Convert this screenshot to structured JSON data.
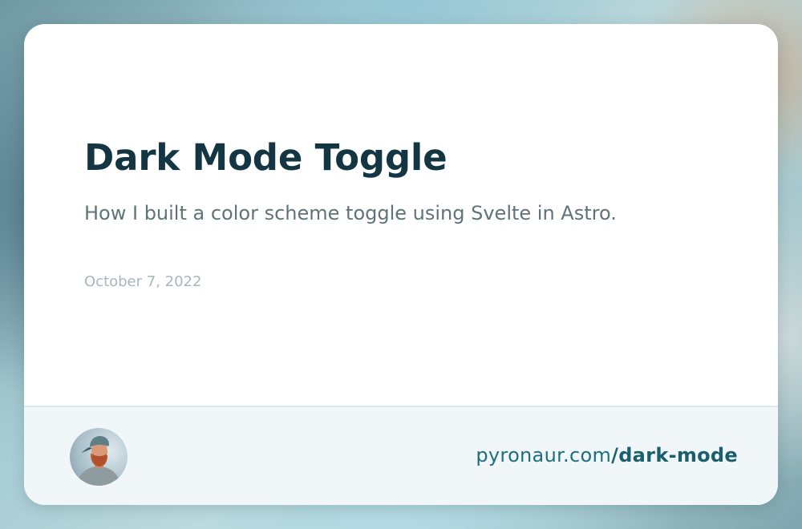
{
  "post": {
    "title": "Dark Mode Toggle",
    "description": "How I built a color scheme toggle using Svelte in Astro.",
    "date": "October 7, 2022"
  },
  "footer": {
    "url_domain": "pyronaur.com",
    "url_path": "/dark-mode",
    "avatar_icon": "author-avatar"
  },
  "colors": {
    "title": "#143642",
    "subtitle": "#5f7378",
    "date": "#a9b6b9",
    "footer_bg": "#f1f7f8",
    "link": "#1d6f80"
  }
}
